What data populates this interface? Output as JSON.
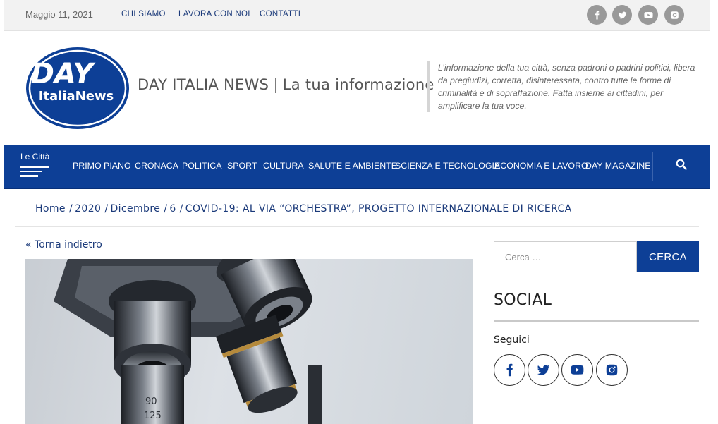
{
  "topbar": {
    "date": "Maggio 11, 2021",
    "links": [
      "CHI SIAMO",
      "LAVORA CON NOI",
      "CONTATTI"
    ],
    "social_icons": [
      "facebook-icon",
      "twitter-icon",
      "youtube-icon",
      "instagram-icon"
    ]
  },
  "header": {
    "logo": {
      "line1": "DAY",
      "line2": "ItaliaNews"
    },
    "site_name": "DAY ITALIA NEWS",
    "separator": "|",
    "site_desc": "La tua informazione",
    "tagline": "L’informazione della tua città, senza padroni o padrini politici, libera da pregiudizi, corretta, disinteressata, contro tutte le forme di criminalità e di sopraffazione. Fatta insieme ai cittadini, per amplificare la tua voce."
  },
  "nav": {
    "citta_label": "Le Città",
    "items": [
      "PRIMO PIANO",
      "CRONACA",
      "POLITICA",
      "SPORT",
      "CULTURA",
      "SALUTE E AMBIENTE",
      "SCIENZA E TECNOLOGIA",
      "ECONOMIA E LAVORO",
      "DAY MAGAZINE"
    ],
    "search_icon": "search-icon"
  },
  "breadcrumb": {
    "items": [
      "Home",
      "2020",
      "Dicembre",
      "6",
      "COVID-19: AL VIA “ORCHESTRA”, PROGETTO INTERNAZIONALE DI RICERCA"
    ],
    "separator": "/"
  },
  "article": {
    "back_link": "« Torna indietro",
    "image_text": [
      "90",
      "125"
    ]
  },
  "sidebar": {
    "search_placeholder": "Cerca …",
    "search_button": "CERCA",
    "social_title": "SOCIAL",
    "follow_label": "Seguici",
    "social_icons": [
      "facebook-icon",
      "twitter-icon",
      "youtube-icon",
      "instagram-icon"
    ]
  },
  "colors": {
    "brand_blue": "#0d3f96",
    "link_blue": "#1b3a7a",
    "topbar_bg": "#f2f2f2"
  }
}
